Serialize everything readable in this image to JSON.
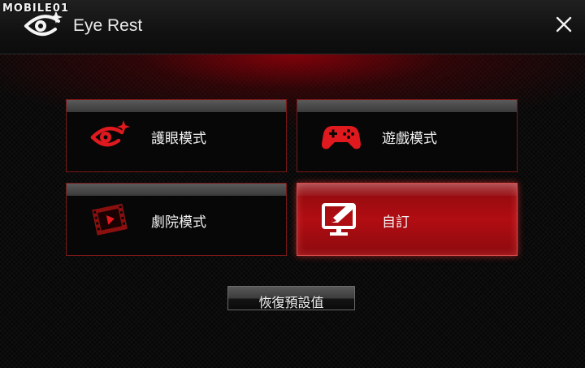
{
  "watermark": "MOBILE01",
  "window": {
    "title": "Eye Rest",
    "app_icon": "eye-sparkle-icon",
    "close_icon": "close-icon"
  },
  "modes": [
    {
      "label": "護眼模式",
      "icon": "eye-care-icon",
      "selected": false
    },
    {
      "label": "遊戲模式",
      "icon": "gamepad-icon",
      "selected": false
    },
    {
      "label": "劇院模式",
      "icon": "film-strip-icon",
      "selected": false
    },
    {
      "label": "自訂",
      "icon": "monitor-edit-icon",
      "selected": true
    }
  ],
  "reset_button": {
    "label": "恢復預設值"
  },
  "colors": {
    "accent": "#d41a1f",
    "selected_tile": "#a80b10",
    "tile_border": "#7a1818",
    "background": "#060606"
  }
}
